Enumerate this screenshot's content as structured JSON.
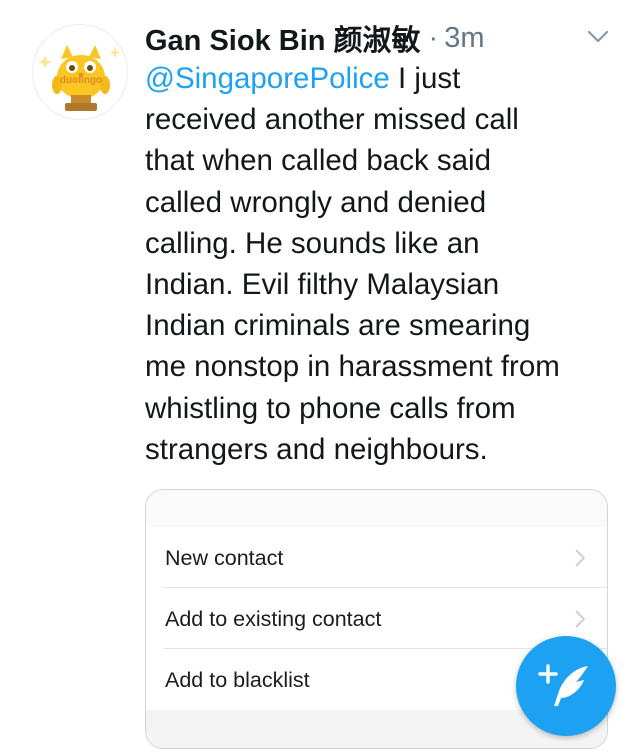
{
  "tweet": {
    "author_name": "Gan Siok Bin 颜淑敏",
    "separator": "·",
    "time": "3m",
    "avatar_text": "duolingo",
    "mention": "@SingaporePolice",
    "text": " I just\nreceived another missed call\nthat when called back said\ncalled wrongly and denied\ncalling. He sounds like an\nIndian. Evil filthy Malaysian\nIndian criminals are smearing\nme nonstop in harassment from\nwhistling to phone calls from\nstrangers and neighbours."
  },
  "media": {
    "menu_items": [
      {
        "label": "New contact",
        "has_chevron": true
      },
      {
        "label": "Add to existing contact",
        "has_chevron": true
      },
      {
        "label": "Add to blacklist",
        "has_chevron": false
      }
    ]
  },
  "colors": {
    "accent": "#1da1f2",
    "text": "#14171a",
    "muted": "#657786",
    "owl_yellow": "#f9c623"
  },
  "icons": {
    "caret": "chevron-down-icon",
    "compose": "compose-tweet-icon",
    "menu_chevron": "chevron-right-icon"
  }
}
